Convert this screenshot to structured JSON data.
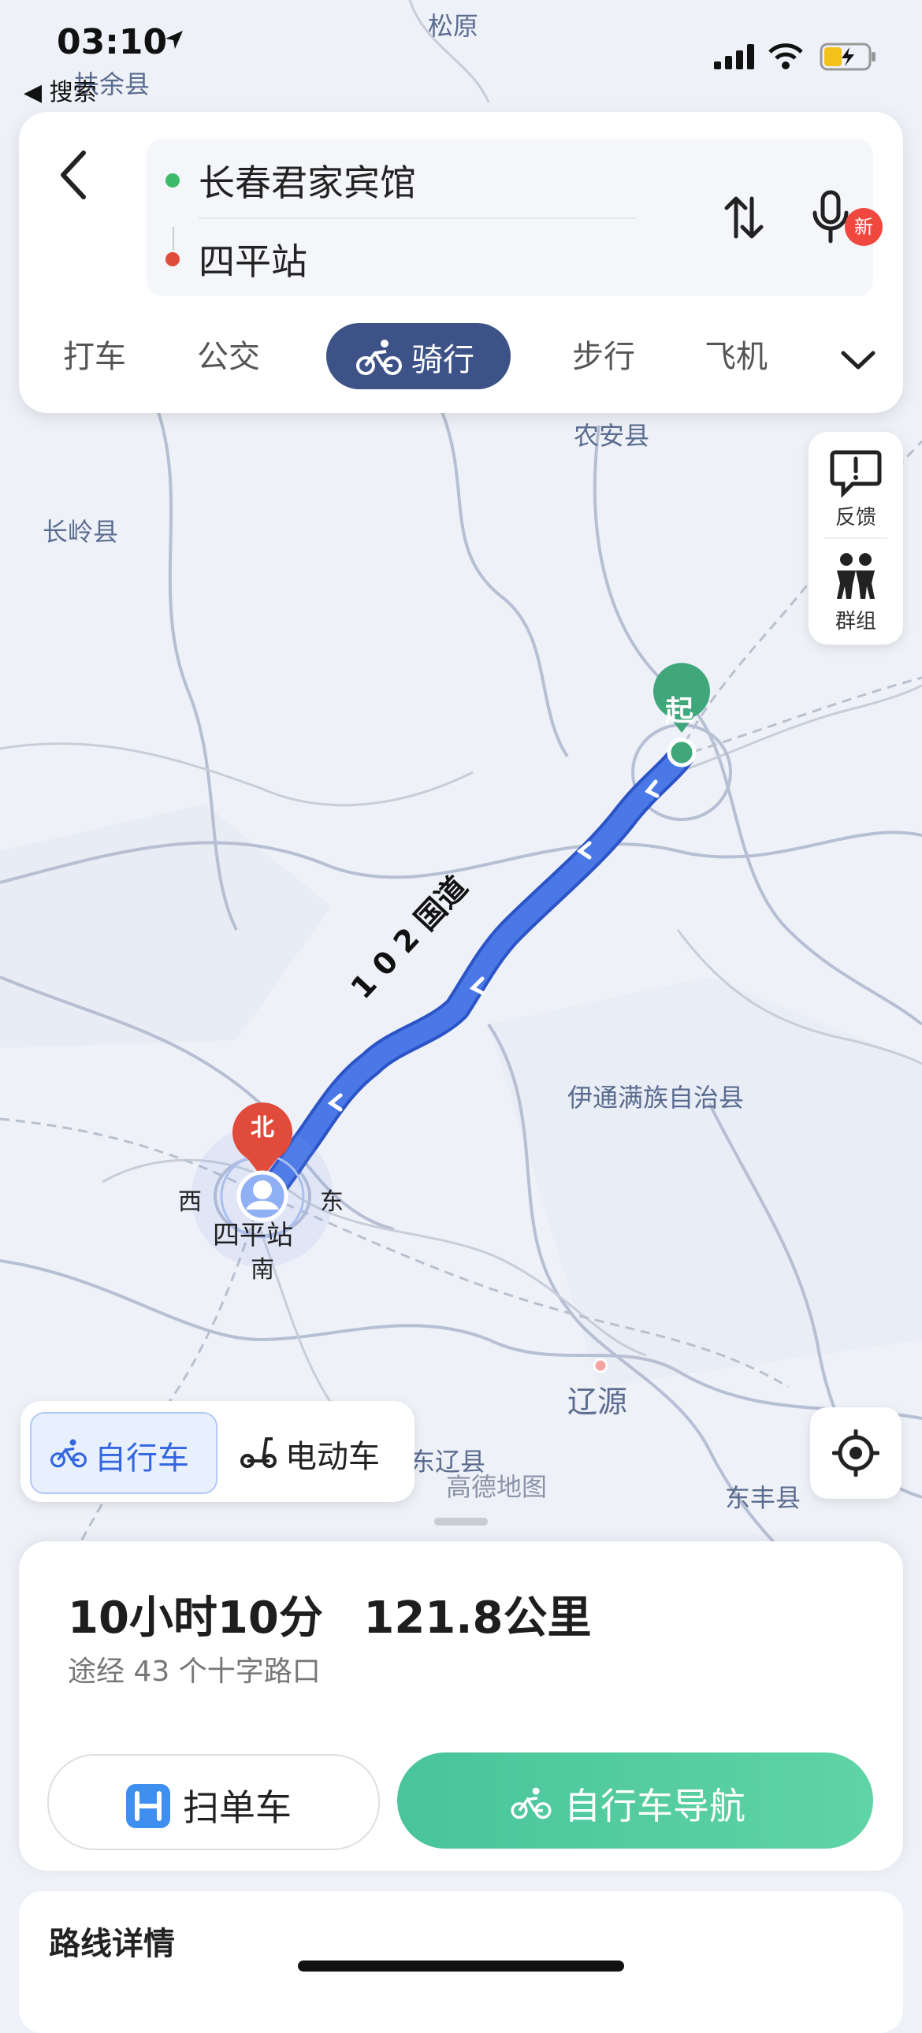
{
  "status_bar": {
    "time": "03:10",
    "back_app": "◀ 搜索"
  },
  "route": {
    "origin": "长春君家宾馆",
    "destination": "四平站"
  },
  "modes": [
    {
      "label": "打车"
    },
    {
      "label": "公交"
    },
    {
      "label": "骑行",
      "active": true
    },
    {
      "label": "步行"
    },
    {
      "label": "飞机"
    }
  ],
  "new_badge": "新",
  "side_panel": {
    "feedback": "反馈",
    "group": "群组"
  },
  "map_labels": {
    "songyuan": "松原",
    "fuyu": "扶余县",
    "nongan": "农安县",
    "changling": "长岭县",
    "yitong": "伊通满族自治县",
    "liaoyuan": "辽源",
    "dongfeng": "东丰县",
    "dongliao": "东辽县",
    "road": "1 0 2 国道",
    "siping_station": "四平站",
    "compass": {
      "n": "北",
      "w": "西",
      "e": "东",
      "s": "南"
    },
    "start_marker": "起",
    "watermark": "高德地图"
  },
  "vehicle_toggle": {
    "bike": "自行车",
    "ebike": "电动车"
  },
  "summary": {
    "duration": "10小时10分",
    "distance": "121.8公里",
    "via": "途经 43 个十字路口"
  },
  "buttons": {
    "scan": "扫单车",
    "navigate": "自行车导航"
  },
  "details": {
    "title": "路线详情"
  },
  "colors": {
    "route_blue": "#4a78e6",
    "active_mode": "#3d5287",
    "nav_green": "#52c9a0",
    "start_green": "#3fa77a",
    "end_red": "#e14b3b"
  }
}
